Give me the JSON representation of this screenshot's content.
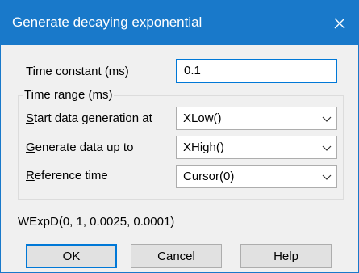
{
  "window": {
    "title": "Generate decaying exponential"
  },
  "time_constant": {
    "label": "Time constant (ms)",
    "value": "0.1"
  },
  "time_range": {
    "title": "Time range (ms)",
    "start": {
      "label_accel": "S",
      "label_rest": "tart data generation at",
      "value": "XLow()"
    },
    "end": {
      "label_accel": "G",
      "label_rest": "enerate data up to",
      "value": "XHigh()"
    },
    "reference": {
      "label_accel": "R",
      "label_rest": "eference time",
      "value": "Cursor(0)"
    }
  },
  "formula": "WExpD(0, 1, 0.0025, 0.0001)",
  "buttons": {
    "ok": "OK",
    "cancel": "Cancel",
    "help": "Help"
  },
  "icons": {
    "close": "close-icon",
    "dropdown": "chevron-down-icon"
  },
  "colors": {
    "titlebar": "#1979ca",
    "focus": "#0078d7"
  }
}
